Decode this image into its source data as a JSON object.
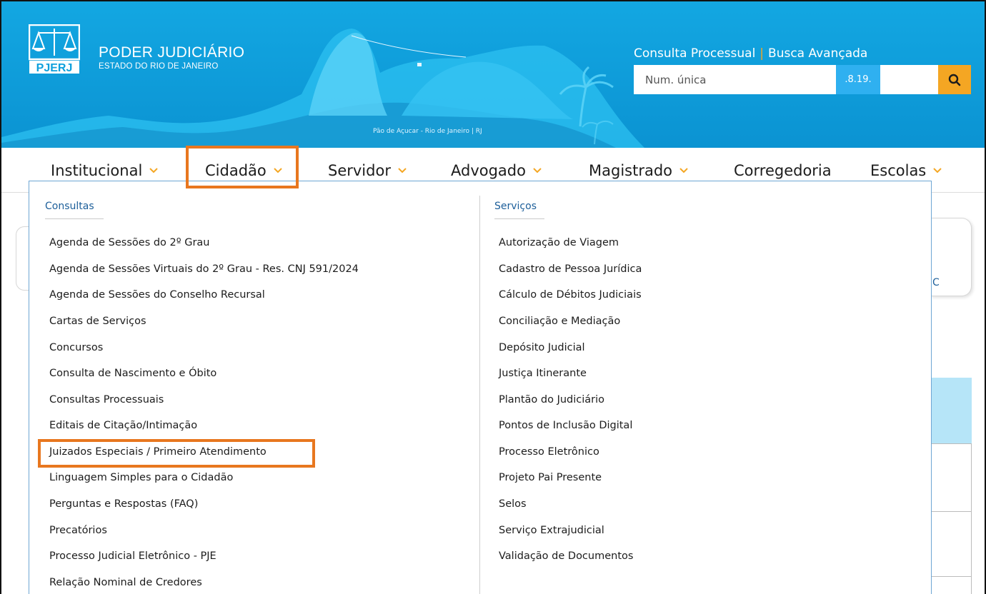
{
  "header": {
    "logo_text": "PJERJ",
    "brand_title": "PODER JUDICIÁRIO",
    "brand_subtitle": "ESTADO DO RIO DE JANEIRO",
    "image_caption": "Pão de Açucar - Rio de Janeiro | RJ",
    "search": {
      "link_consulta": "Consulta Processual",
      "separator": "|",
      "link_busca": "Busca Avançada",
      "placeholder": "Num. única",
      "segment_label": ".8.19.",
      "button_icon": "search-icon"
    }
  },
  "nav": {
    "items": [
      {
        "label": "Institucional"
      },
      {
        "label": "Cidadão"
      },
      {
        "label": "Servidor"
      },
      {
        "label": "Advogado"
      },
      {
        "label": "Magistrado"
      },
      {
        "label": "Corregedoria"
      },
      {
        "label": "Escolas"
      }
    ]
  },
  "dropdown": {
    "consultas": {
      "heading": "Consultas",
      "items": [
        "Agenda de Sessões do 2º Grau",
        "Agenda de Sessões Virtuais do 2º Grau - Res. CNJ 591/2024",
        "Agenda de Sessões do Conselho Recursal",
        "Cartas de Serviços",
        "Concursos",
        "Consulta de Nascimento e Óbito",
        "Consultas Processuais",
        "Editais de Citação/Intimação",
        "Juizados Especiais / Primeiro Atendimento",
        "Linguagem Simples para o Cidadão",
        "Perguntas e Respostas (FAQ)",
        "Precatórios",
        "Processo Judicial Eletrônico - PJE",
        "Relação Nominal de Credores"
      ]
    },
    "servicos": {
      "heading": "Serviços",
      "items": [
        "Autorização de Viagem",
        "Cadastro de Pessoa Jurídica",
        "Cálculo de Débitos Judiciais",
        "Conciliação e Mediação",
        "Depósito Judicial",
        "Justiça Itinerante",
        "Plantão do Judiciário",
        "Pontos de Inclusão Digital",
        "Processo Eletrônico",
        "Projeto Pai Presente",
        "Selos",
        "Serviço Extrajudicial",
        "Validação de Documentos"
      ]
    }
  },
  "background": {
    "card_fragment": "C"
  },
  "colors": {
    "header_blue": "#0ea0dc",
    "accent_orange": "#f4a623",
    "highlight_orange": "#e8771f",
    "heading_blue": "#1d5f9a"
  }
}
